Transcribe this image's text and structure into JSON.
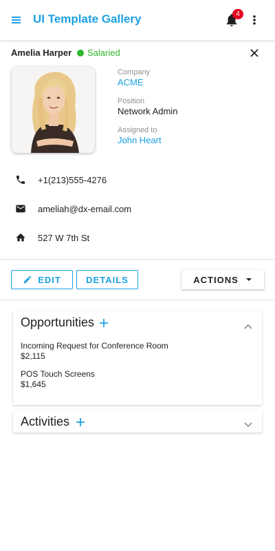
{
  "appbar": {
    "title": "UI Template Gallery",
    "notification_count": "4",
    "accent": "#1ba0e2",
    "badge_color": "#e5001e"
  },
  "employee": {
    "name": "Amelia Harper",
    "status": "Salaried",
    "status_color": "#2eb52c",
    "company_label": "Company",
    "company": "ACME",
    "position_label": "Position",
    "position": "Network Admin",
    "assigned_label": "Assigned to",
    "assigned_to": "John Heart",
    "phone": "+1(213)555-4276",
    "email": "ameliah@dx-email.com",
    "address": "527 W 7th St"
  },
  "toolbar": {
    "edit_label": "EDIT",
    "details_label": "DETAILS",
    "actions_label": "ACTIONS"
  },
  "opportunities": {
    "title": "Opportunities",
    "expanded": true,
    "items": [
      {
        "name": "Incoming Request for Conference Room",
        "amount": "$2,115"
      },
      {
        "name": "POS Touch Screens",
        "amount": "$1,645"
      }
    ]
  },
  "activities": {
    "title": "Activities",
    "expanded": false
  },
  "icons": {
    "menu": "menu-icon",
    "bell": "bell-icon",
    "more": "more-vertical-icon",
    "close": "close-icon",
    "phone": "phone-icon",
    "email": "email-icon",
    "home": "home-icon",
    "edit": "pencil-icon",
    "dropdown": "caret-down-icon",
    "add": "plus-icon",
    "chevron_up": "chevron-up-icon",
    "chevron_down": "chevron-down-icon"
  }
}
